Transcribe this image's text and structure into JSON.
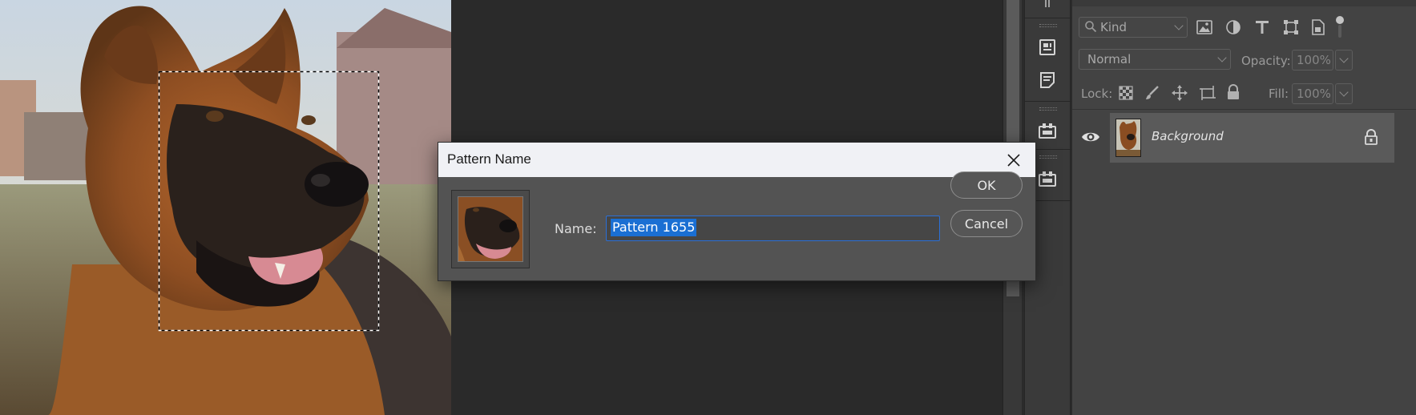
{
  "dialog": {
    "title": "Pattern Name",
    "name_label": "Name:",
    "name_value": "Pattern 1655",
    "ok_label": "OK",
    "cancel_label": "Cancel",
    "close_icon": "close-icon"
  },
  "layers_panel": {
    "filter": {
      "kind_label": "Kind",
      "icons": [
        "image-filter-icon",
        "adjustment-filter-icon",
        "type-filter-icon",
        "shape-filter-icon",
        "smart-object-filter-icon",
        "filter-toggle-icon"
      ]
    },
    "blend_mode": "Normal",
    "opacity_label": "Opacity:",
    "opacity_value": "100%",
    "lock_label": "Lock:",
    "lock_icons": [
      "lock-transparent-icon",
      "lock-image-icon",
      "lock-position-icon",
      "lock-artboard-icon",
      "lock-all-icon"
    ],
    "fill_label": "Fill:",
    "fill_value": "100%",
    "layers": [
      {
        "name": "Background",
        "visible": true,
        "locked": true
      }
    ]
  },
  "side_strip": {
    "icons": [
      "properties-icon",
      "notes-icon",
      "libraries-icon",
      "libraries-alt-icon"
    ]
  },
  "colors": {
    "accent": "#1a6fd3",
    "dialog_bg": "#535353",
    "titlebar_bg": "#f0f1f5",
    "panel_bg": "#434343",
    "selection_row": "#5a5a5a"
  }
}
